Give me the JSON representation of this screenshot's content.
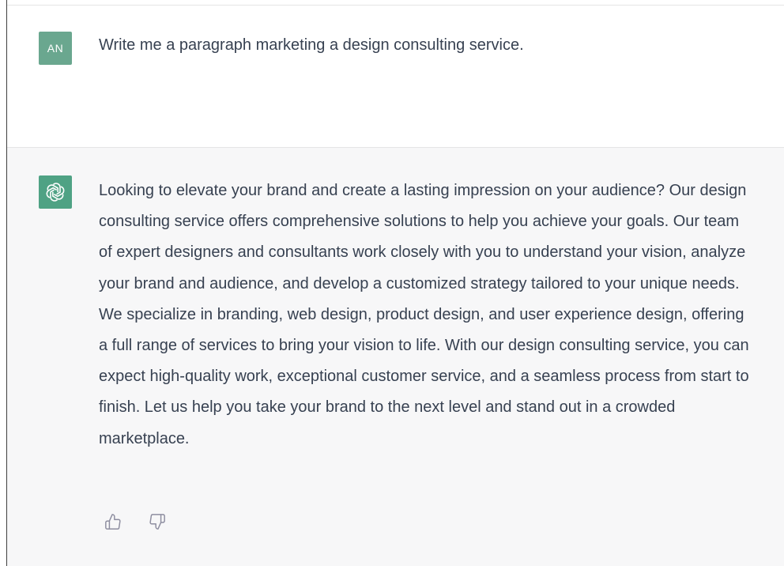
{
  "conversation": {
    "user_message": {
      "avatar_initials": "AN",
      "text": "Write me a paragraph marketing a design consulting service."
    },
    "assistant_message": {
      "avatar_icon": "openai-logo-icon",
      "text": "Looking to elevate your brand and create a lasting impression on your audience? Our design consulting service offers comprehensive solutions to help you achieve your goals. Our team of expert designers and consultants work closely with you to understand your vision, analyze your brand and audience, and develop a customized strategy tailored to your unique needs. We specialize in branding, web design, product design, and user experience design, offering a full range of services to bring your vision to life. With our design consulting service, you can expect high-quality work, exceptional customer service, and a seamless process from start to finish. Let us help you take your brand to the next level and stand out in a crowded marketplace.",
      "feedback": {
        "thumbs_up_icon": "thumbs-up-icon",
        "thumbs_down_icon": "thumbs-down-icon"
      }
    }
  },
  "colors": {
    "user_bg": "#ffffff",
    "assistant_bg": "#f7f7f8",
    "user_avatar": "#6aa78f",
    "assistant_avatar": "#4fa284",
    "text": "#374151"
  }
}
